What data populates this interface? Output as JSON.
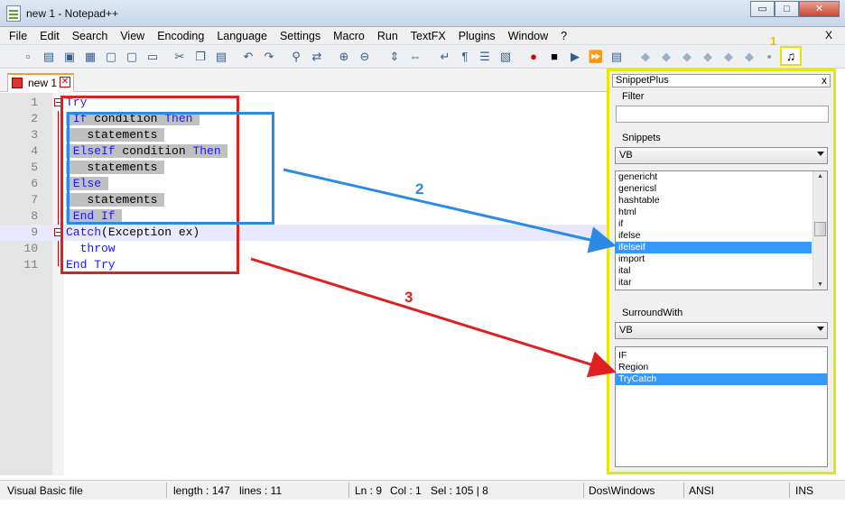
{
  "window": {
    "title": "new  1 - Notepad++",
    "minimize": "▭",
    "maximize": "□",
    "close": "✕"
  },
  "menu": {
    "items": [
      "File",
      "Edit",
      "Search",
      "View",
      "Encoding",
      "Language",
      "Settings",
      "Macro",
      "Run",
      "TextFX",
      "Plugins",
      "Window",
      "?"
    ],
    "close": "X"
  },
  "toolbar": {
    "icons": [
      "new-file-icon",
      "open-file-icon",
      "save-icon",
      "save-all-icon",
      "close-icon",
      "close-all-icon",
      "print-icon",
      "cut-icon",
      "copy-icon",
      "paste-icon",
      "undo-icon",
      "redo-icon",
      "find-icon",
      "replace-icon",
      "zoom-in-icon",
      "zoom-out-icon",
      "sync-v-icon",
      "sync-h-icon",
      "wrap-icon",
      "all-chars-icon",
      "indent-guide-icon",
      "user-lang-icon",
      "record-icon",
      "stop-icon",
      "play-icon",
      "play-multi-icon",
      "save-macro-icon"
    ],
    "plugin_button": "♫",
    "annotation": "1"
  },
  "tab": {
    "label": "new  1",
    "close": "✕"
  },
  "editor": {
    "lines": [
      {
        "n": "1",
        "parts": [
          {
            "t": "Try",
            "c": "kw"
          }
        ]
      },
      {
        "n": "2",
        "parts": [
          {
            "t": " If",
            "c": "kw sel"
          },
          {
            "t": " condition ",
            "c": "sel"
          },
          {
            "t": "Then",
            "c": "kw sel"
          },
          {
            "t": " ",
            "c": "sel"
          }
        ]
      },
      {
        "n": "3",
        "parts": [
          {
            "t": "   statements ",
            "c": "sel"
          }
        ]
      },
      {
        "n": "4",
        "parts": [
          {
            "t": " ElseIf",
            "c": "kw sel"
          },
          {
            "t": " condition ",
            "c": "sel"
          },
          {
            "t": "Then",
            "c": "kw sel"
          },
          {
            "t": " ",
            "c": "sel"
          }
        ]
      },
      {
        "n": "5",
        "parts": [
          {
            "t": "   statements ",
            "c": "sel"
          }
        ]
      },
      {
        "n": "6",
        "parts": [
          {
            "t": " Else",
            "c": "kw sel"
          },
          {
            "t": " ",
            "c": "sel"
          }
        ]
      },
      {
        "n": "7",
        "parts": [
          {
            "t": "   statements ",
            "c": "sel"
          }
        ]
      },
      {
        "n": "8",
        "parts": [
          {
            "t": " End If",
            "c": "kw sel"
          },
          {
            "t": " ",
            "c": "sel"
          }
        ]
      },
      {
        "n": "9",
        "parts": [
          {
            "t": "Catch",
            "c": "kw"
          },
          {
            "t": "(Exception ex)",
            "c": ""
          }
        ]
      },
      {
        "n": "10",
        "parts": [
          {
            "t": "  throw",
            "c": "kw"
          }
        ]
      },
      {
        "n": "11",
        "parts": [
          {
            "t": "End Try",
            "c": "kw"
          }
        ]
      }
    ]
  },
  "panel": {
    "title": "SnippetPlus",
    "close": "x",
    "filter_label": "Filter",
    "filter_value": "",
    "snippets_label": "Snippets",
    "snippets_lang": "VB",
    "snippets": [
      "genericht",
      "genericsl",
      "hashtable",
      "html",
      "if",
      "ifelse",
      "ifelseif",
      "import",
      "ital",
      "itar"
    ],
    "snippets_selected": "ifelseif",
    "surround_label": "SurroundWith",
    "surround_lang": "VB",
    "surround": [
      "IF",
      "Region",
      "TryCatch"
    ],
    "surround_selected": "TryCatch"
  },
  "annotations": {
    "two": "2",
    "three": "3"
  },
  "status": {
    "filetype": "Visual Basic file",
    "length": "length : 147",
    "lines": "lines : 11",
    "ln": "Ln : 9",
    "col": "Col : 1",
    "sel": "Sel : 105 | 8",
    "eol": "Dos\\Windows",
    "encoding": "ANSI",
    "mode": "INS"
  },
  "colors": {
    "keyword": "#1a1aff",
    "selection": "#c0c0c0",
    "red_box": "#e02020",
    "blue_box": "#2a8ae6",
    "panel_border": "#e8e800",
    "list_selected": "#3399ff"
  }
}
